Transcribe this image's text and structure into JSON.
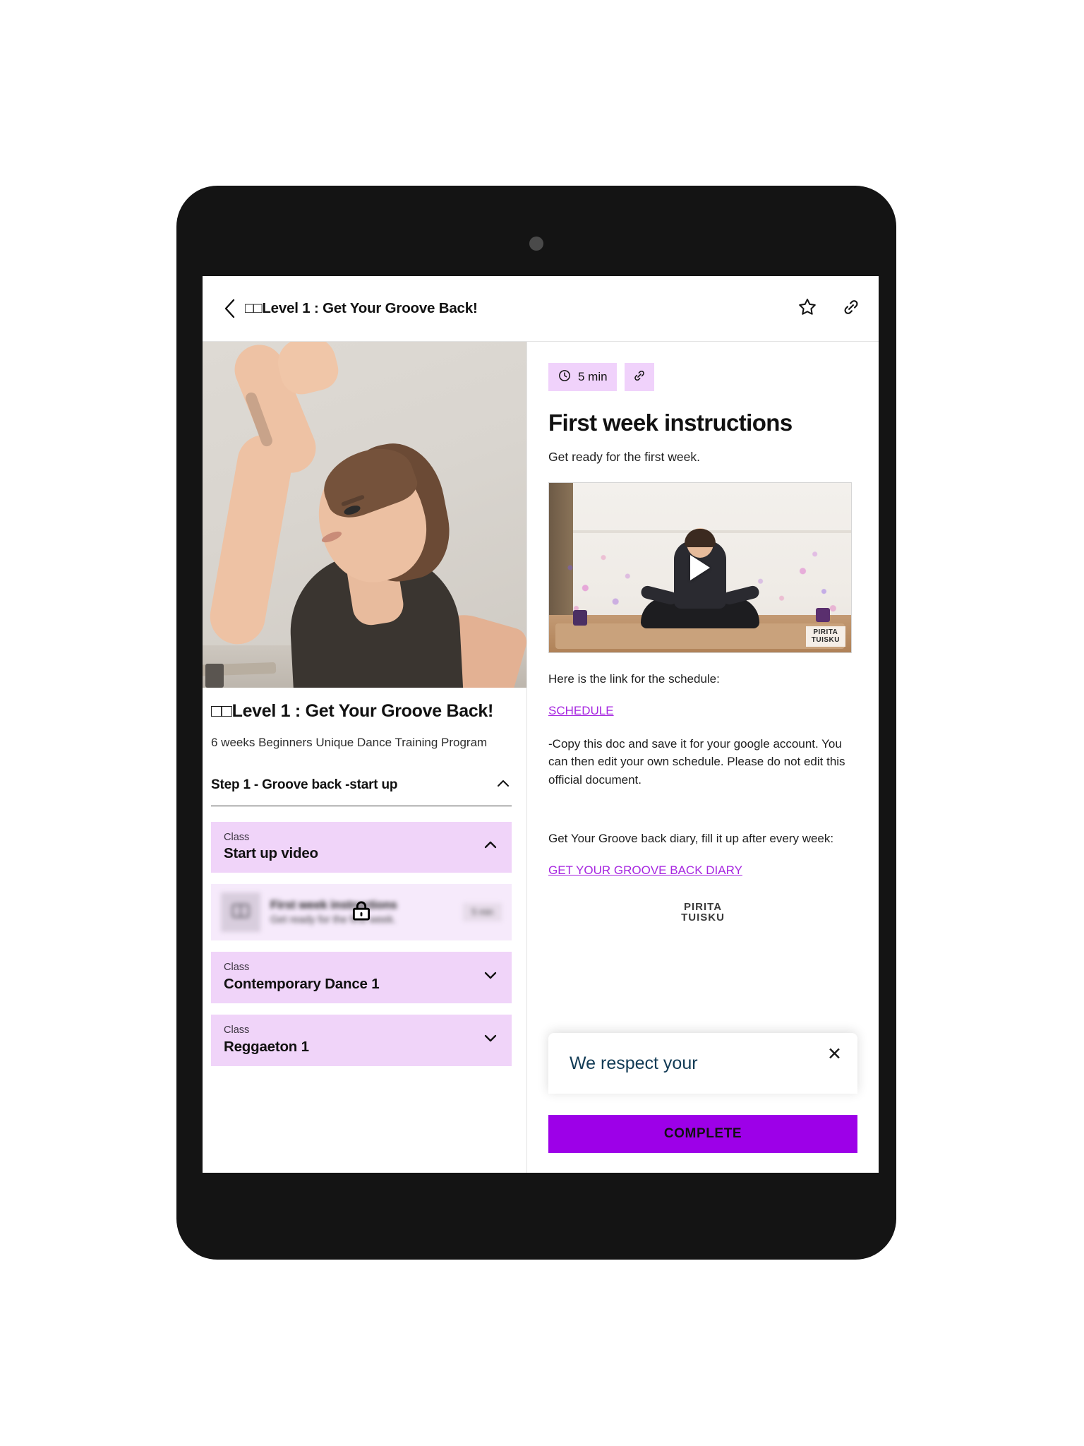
{
  "appbar": {
    "back_icon": "chevron-left-icon",
    "title": "□□Level 1 : Get Your Groove Back!",
    "favorite_icon": "star-outline-icon",
    "share_icon": "link-icon"
  },
  "left_pane": {
    "hero_alt": "woman flexing arm looking up",
    "course_title": "□□Level 1 : Get Your Groove Back!",
    "course_subtitle": "6 weeks Beginners Unique Dance Training Program",
    "step": {
      "label": "Step 1 - Groove back -start up",
      "chevron": "chevron-up-icon"
    },
    "items": [
      {
        "kind": "class",
        "kicker": "Class",
        "name": "Start up video",
        "chevron": "chevron-up-icon",
        "expanded": true
      },
      {
        "kind": "lesson",
        "locked": true,
        "thumb_icon": "book-icon",
        "title": "First week instructions",
        "desc": "Get ready for the first week.",
        "duration": "5 min",
        "lock_icon": "lock-icon"
      },
      {
        "kind": "class",
        "kicker": "Class",
        "name": "Contemporary Dance 1",
        "chevron": "chevron-down-icon",
        "expanded": false
      },
      {
        "kind": "class",
        "kicker": "Class",
        "name": "Reggaeton 1",
        "chevron": "chevron-down-icon",
        "expanded": false
      }
    ]
  },
  "right_pane": {
    "duration_chip": {
      "icon": "clock-icon",
      "text": "5 min"
    },
    "link_chip": {
      "icon": "link-icon"
    },
    "heading": "First week instructions",
    "lead": "Get ready for the first week.",
    "video": {
      "play_icon": "play-icon",
      "watermark_line1": "PIRITA",
      "watermark_line2": "TUISKU"
    },
    "paragraph_1": "Here is the link for the schedule:",
    "link_schedule": "SCHEDULE",
    "paragraph_2": "-Copy this doc and save it for your google account. You can then edit your own schedule. Please do not edit this official document.",
    "paragraph_3": "Get Your Groove back diary, fill it up after every week:",
    "link_diary": "GET YOUR GROOVE BACK DIARY",
    "logo_line1": "PIRITA",
    "logo_line2": "TUISKU",
    "complete_button": "COMPLETE"
  },
  "cookie_dialog": {
    "title": "We respect your",
    "close_icon": "close-icon"
  },
  "colors": {
    "accent_purple": "#9d00e8",
    "link_purple": "#a626e0",
    "card_lavender": "#f0d4f9",
    "chip_lavender": "#f0d2fb",
    "device_bezel": "#141414",
    "dialog_text": "#123b55"
  }
}
